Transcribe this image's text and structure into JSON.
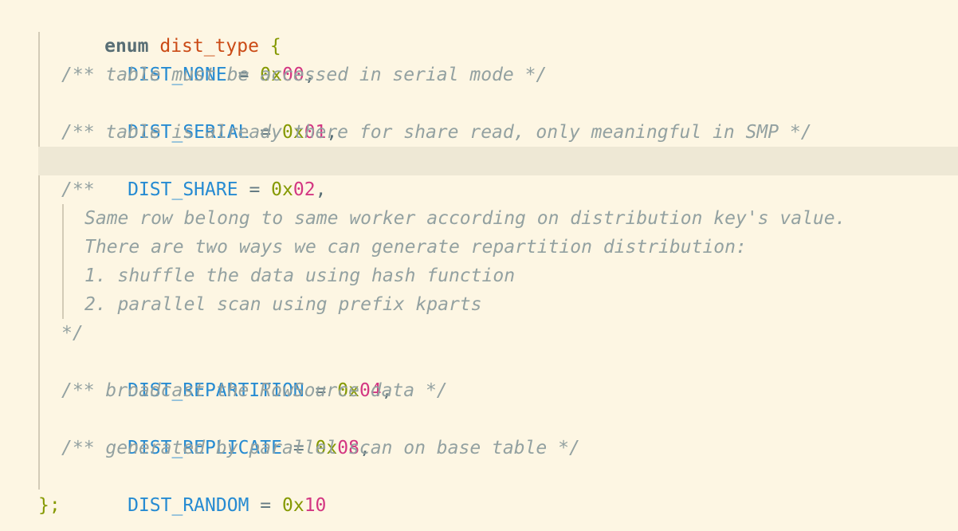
{
  "code": {
    "enum_keyword": "enum",
    "enum_name": "dist_type",
    "open_brace": "{",
    "close_brace": "};",
    "entries": [
      {
        "name": "DIST_NONE",
        "eq": "=",
        "prefix": "0x",
        "value": "00",
        "sep": ","
      },
      {
        "name": "DIST_SERIAL",
        "eq": "=",
        "prefix": "0x",
        "value": "01",
        "sep": ","
      },
      {
        "name": "DIST_SHARE",
        "eq": "=",
        "prefix": "0x",
        "value": "02",
        "sep": ","
      },
      {
        "name": "DIST_REPARTITION",
        "eq": "=",
        "prefix": "0x",
        "value": "04",
        "sep": ","
      },
      {
        "name": "DIST_REPLICATE",
        "eq": "=",
        "prefix": "0x",
        "value": "08",
        "sep": ","
      },
      {
        "name": "DIST_RANDOM",
        "eq": "=",
        "prefix": "0x",
        "value": "10",
        "sep": ""
      }
    ],
    "comments": {
      "serial": "/** table must be accessed in serial mode */",
      "share": "/** table is already there for share read, only meaningful in SMP */",
      "repartition_open": "/**",
      "repartition_lines": [
        "Same row belong to same worker according on distribution key's value.",
        "There are two ways we can generate repartition distribution:",
        "1. shuffle the data using hash function",
        "2. parallel scan using prefix kparts"
      ],
      "repartition_close": "*/",
      "replicate": "/** broadcast the RowSource data */",
      "random": "/** generated by parallel scan on base table */"
    }
  },
  "colors": {
    "background": "#fdf6e3",
    "highlight_line": "#eee8d5",
    "keyword": "#586e75",
    "type_name": "#cb4b16",
    "brace": "#859900",
    "constant": "#268bd2",
    "number": "#d33682",
    "comment": "#93a1a1"
  }
}
